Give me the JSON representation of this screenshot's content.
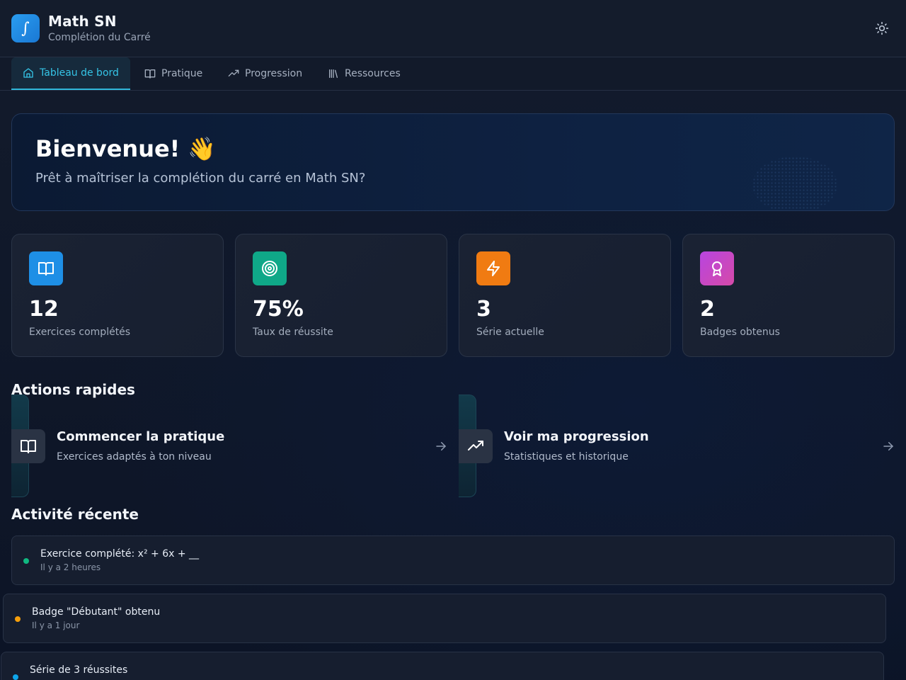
{
  "header": {
    "logo_glyph": "∫",
    "title": "Math SN",
    "subtitle": "Complétion du Carré",
    "theme_icon": "sun-icon"
  },
  "nav": {
    "tabs": [
      {
        "label": "Tableau de bord",
        "icon": "home-icon",
        "active": true
      },
      {
        "label": "Pratique",
        "icon": "book-icon",
        "active": false
      },
      {
        "label": "Progression",
        "icon": "trending-up-icon",
        "active": false
      },
      {
        "label": "Ressources",
        "icon": "library-icon",
        "active": false
      }
    ]
  },
  "welcome": {
    "title": "Bienvenue! 👋",
    "subtitle": "Prêt à maîtriser la complétion du carré en Math SN?"
  },
  "stats": [
    {
      "value": "12",
      "label": "Exercices complétés",
      "icon": "book-icon",
      "color": "#1e8fe6"
    },
    {
      "value": "75%",
      "label": "Taux de réussite",
      "icon": "target-icon",
      "color": "#0fa888"
    },
    {
      "value": "3",
      "label": "Série actuelle",
      "icon": "lightning-icon",
      "color": "#f07b12"
    },
    {
      "value": "2",
      "label": "Badges obtenus",
      "icon": "award-icon",
      "color": "#c445d8"
    }
  ],
  "quick_actions": {
    "title": "Actions rapides",
    "items": [
      {
        "title": "Commencer la pratique",
        "subtitle": "Exercices adaptés à ton niveau",
        "icon": "book-icon"
      },
      {
        "title": "Voir ma progression",
        "subtitle": "Statistiques et historique",
        "icon": "trending-up-icon"
      }
    ]
  },
  "recent": {
    "title": "Activité récente",
    "items": [
      {
        "title": "Exercice complété: x² + 6x + __",
        "time": "Il y a 2 heures",
        "color": "#10b981"
      },
      {
        "title": "Badge \"Débutant\" obtenu",
        "time": "Il y a 1 jour",
        "color": "#f59e0b"
      },
      {
        "title": "Série de 3 réussites",
        "time": "",
        "color": "#0ea5e9"
      }
    ]
  }
}
